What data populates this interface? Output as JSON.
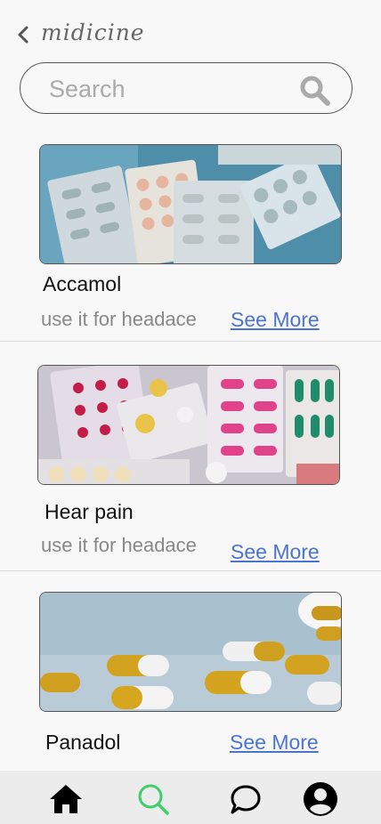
{
  "header": {
    "title": "midicine",
    "back_icon": "chevron-left-icon"
  },
  "search": {
    "placeholder": "Search",
    "icon": "search-icon"
  },
  "medicines": [
    {
      "name": "Accamol",
      "description": "use it for headace",
      "link": "See More",
      "image": "blister-packs-blue"
    },
    {
      "name": "Hear pain",
      "description": "use it for headace",
      "link": "See More",
      "image": "assorted-pills-pink-green"
    },
    {
      "name": "Panadol",
      "description": "",
      "link": "See More",
      "image": "yellow-white-capsules"
    }
  ],
  "nav": {
    "items": [
      {
        "icon": "home-icon",
        "active": false
      },
      {
        "icon": "search-icon",
        "active": true
      },
      {
        "icon": "chat-icon",
        "active": false
      },
      {
        "icon": "profile-icon",
        "active": false
      }
    ],
    "active_color": "#3ecf6a"
  }
}
